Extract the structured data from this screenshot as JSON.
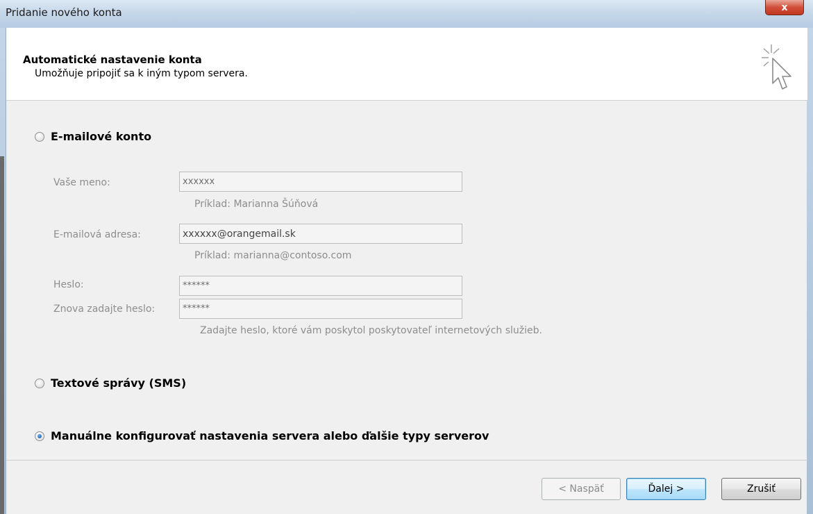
{
  "window": {
    "title": "Pridanie nového konta",
    "close_glyph": "x"
  },
  "header": {
    "title": "Automatické nastavenie konta",
    "subtitle": "Umožňuje pripojiť sa k iným typom servera.",
    "icon": "cursor-sparkle-icon"
  },
  "options": {
    "email_account": {
      "label": "E-mailové konto",
      "checked": false
    },
    "sms": {
      "label": "Textové správy (SMS)",
      "checked": false
    },
    "manual": {
      "label": "Manuálne konfigurovať nastavenia servera alebo ďalšie typy serverov",
      "checked": true
    }
  },
  "form": {
    "name_label": "Vaše meno:",
    "name_value": "xxxxxx",
    "name_hint": "Príklad: Marianna Šúňová",
    "email_label": "E-mailová adresa:",
    "email_value": "xxxxxx@orangemail.sk",
    "email_hint": "Príklad: marianna@contoso.com",
    "password_label": "Heslo:",
    "password_value": "******",
    "password_repeat_label": "Znova zadajte heslo:",
    "password_repeat_value": "******",
    "password_hint": "Zadajte heslo, ktoré vám poskytol poskytovateľ internetových služieb."
  },
  "buttons": {
    "back": "< Naspäť",
    "next": "Ďalej >",
    "cancel": "Zrušiť"
  },
  "colors": {
    "close_button": "#c2371f",
    "default_button_border": "#3c7fb1",
    "disabled_text": "#8d8d8d"
  }
}
